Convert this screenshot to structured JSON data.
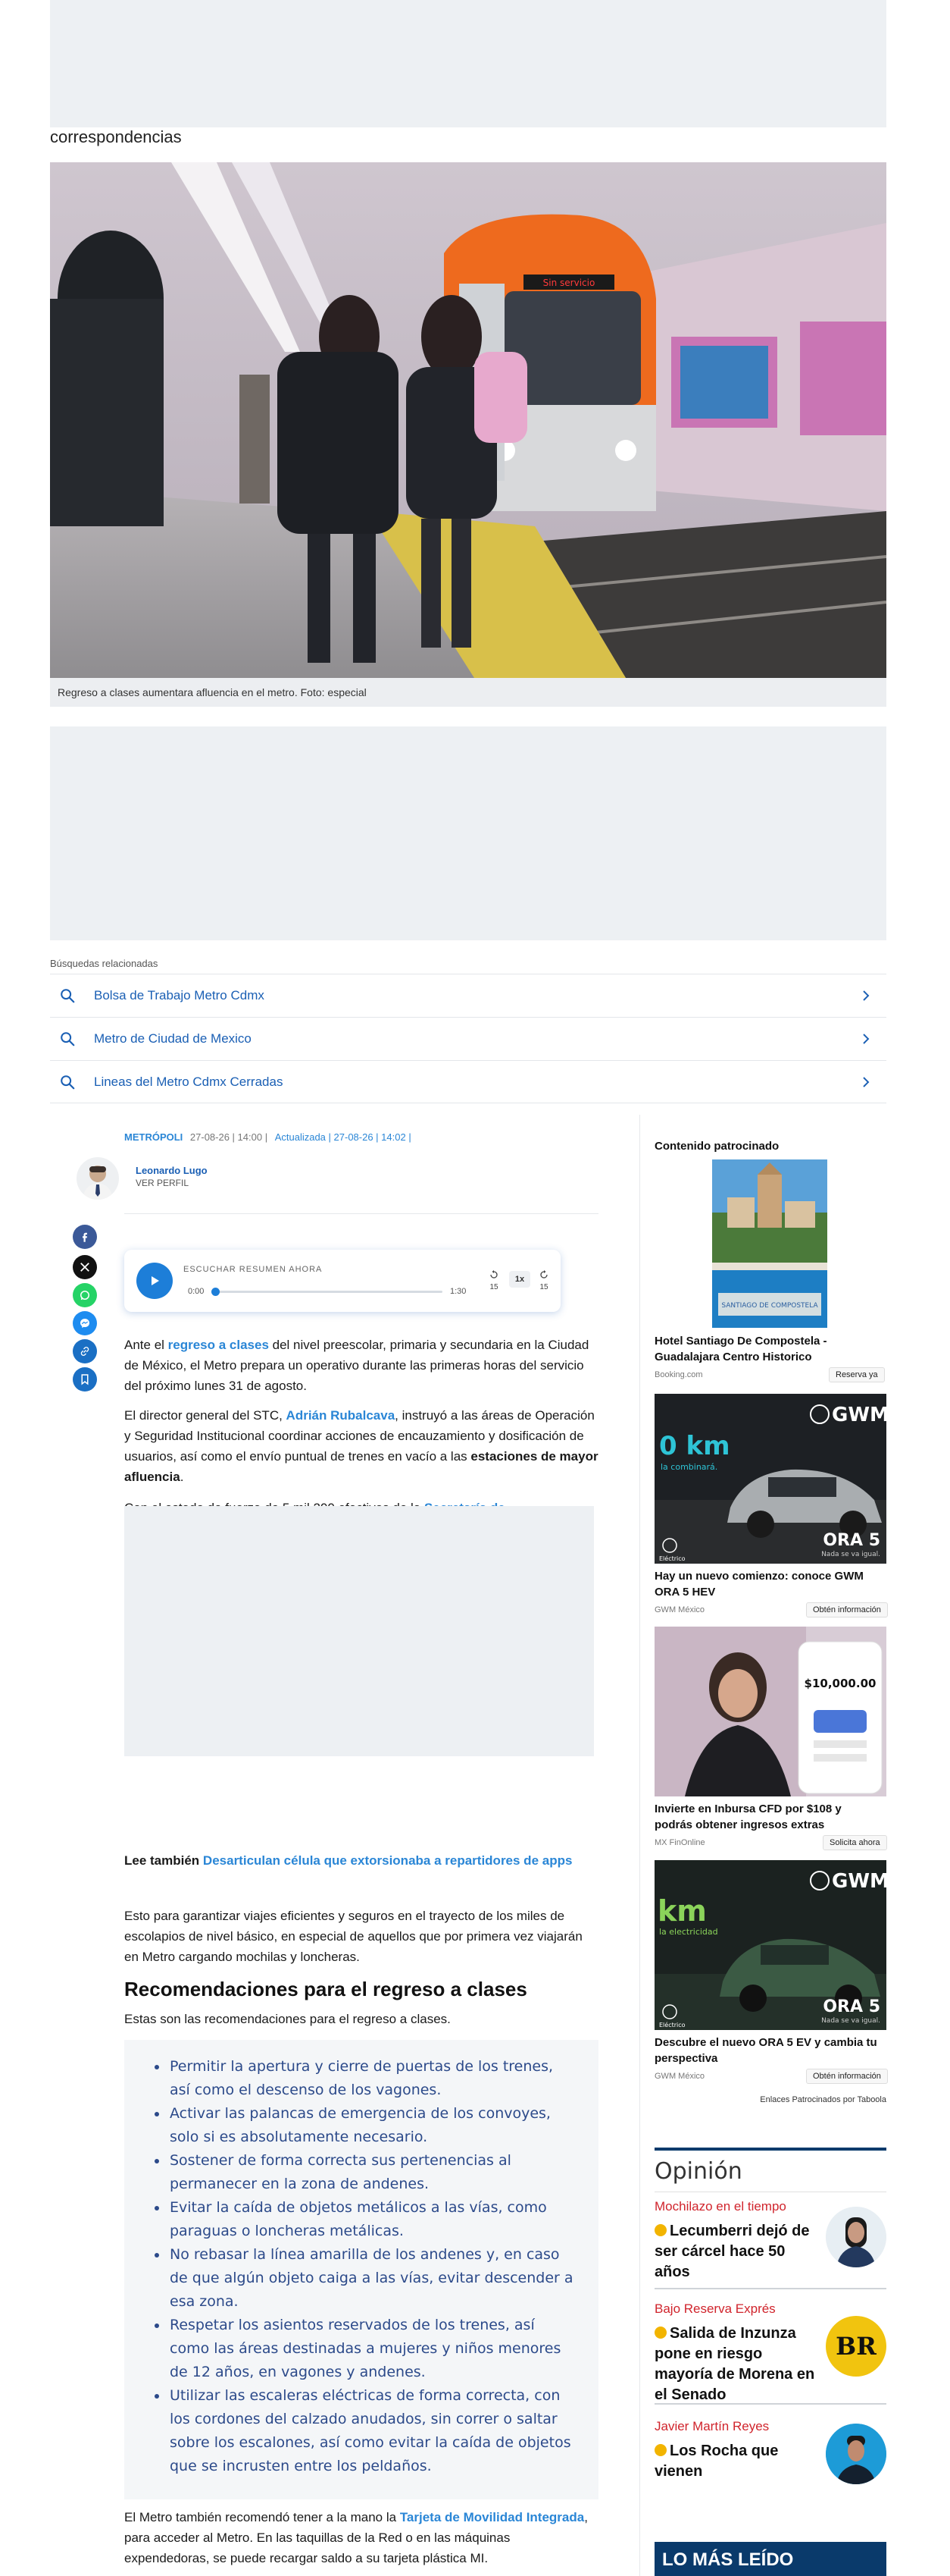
{
  "top_label": "correspondencias",
  "hero": {
    "caption": "Regreso a clases aumentara afluencia en el metro. Foto: especial",
    "train_sign": "Sin servicio"
  },
  "related": {
    "title": "Búsquedas relacionadas",
    "items": [
      "Bolsa de Trabajo Metro Cdmx",
      "Metro de Ciudad de Mexico",
      "Lineas del Metro Cdmx Cerradas"
    ]
  },
  "meta": {
    "section": "METRÓPOLI",
    "date": "27-08-26 | 14:00 |",
    "updated_label": "Actualizada",
    "updated_date": "| 27-08-26 | 14:02 |"
  },
  "author": {
    "name": "Leonardo Lugo",
    "profile_link": "VER PERFIL"
  },
  "audio": {
    "label": "ESCUCHAR RESUMEN AHORA",
    "current": "0:00",
    "duration": "1:30",
    "progress": 0.0,
    "rewind": "15",
    "forward": "15",
    "speed": "1x"
  },
  "article": {
    "p1_a": "Ante el ",
    "p1_link": "regreso a clases",
    "p1_b": " del nivel preescolar, primaria y secundaria en la Ciudad de México, el Metro prepara un operativo durante las primeras horas del servicio del próximo lunes 31 de agosto.",
    "p2_a": "El director general del STC, ",
    "p2_link": "Adrián Rubalcava",
    "p2_b": ", instruyó a las áreas de Operación y Seguridad Institucional coordinar acciones de encauzamiento y dosificación de usuarios, así como el envío puntual de trenes en vacío a las ",
    "p2_bold": "estaciones de mayor afluencia",
    "p2_c": ".",
    "p3_cut_a": "Con el estado de fuerza de 5 mil 200 efectivos de la ",
    "p3_cut_link": "Secretaría de",
    "also_label": "Lee también ",
    "also_link": "Desarticulan célula que extorsionaba a repartidores de apps",
    "p4": "Esto para garantizar viajes eficientes y seguros en el trayecto de los miles de escolapios de nivel básico, en especial de aquellos que por primera vez viajarán en Metro cargando mochilas y loncheras.",
    "h2": "Recomendaciones para el regreso a clases",
    "p5": "Estas son las recomendaciones para el regreso a clases.",
    "recommendations": [
      "Permitir la apertura y cierre de puertas de los trenes, así como el descenso de los vagones.",
      "Activar las palancas de emergencia de los convoyes, solo si es absolutamente necesario.",
      "Sostener de forma correcta sus pertenencias al permanecer en la zona de andenes.",
      "Evitar la caída de objetos metálicos a las vías, como paraguas o loncheras metálicas.",
      "No rebasar la línea amarilla de los andenes y, en caso de que algún objeto caiga a las vías, evitar descender a esa zona.",
      "Respetar los asientos reservados de los trenes, así como las áreas destinadas a mujeres y niños menores de 12 años, en vagones y andenes.",
      "Utilizar las escaleras eléctricas de forma correcta, con los cordones del calzado anudados, sin correr o saltar sobre los escalones, así como evitar la caída de objetos que se incrusten entre los peldaños."
    ],
    "p6_a": "El Metro también recomendó tener a la mano la ",
    "p6_link": "Tarjeta de Movilidad Integrada",
    "p6_b": ", para acceder al Metro. En las taquillas de la Red o en las máquinas expendedoras, se puede recargar saldo a su tarjeta plástica MI."
  },
  "sponsored": {
    "title": "Contenido patrocinado",
    "footer": "Enlaces Patrocinados por Taboola",
    "items": [
      {
        "title": "Hotel Santiago De Compostela - Guadalajara Centro Historico",
        "source": "Booking.com",
        "cta": "Reserva ya",
        "img_text": "SANTIAGO DE COMPOSTELA"
      },
      {
        "title": "Hay un nuevo comienzo: conoce GWM ORA 5 HEV",
        "source": "GWM México",
        "cta": "Obtén información",
        "brand": "GWM",
        "big": "0 km",
        "sub": "la combinará.",
        "model": "ORA 5",
        "model_sub": "Nada se va igual.",
        "tag": "Eléctrico"
      },
      {
        "title": "Invierte en Inbursa CFD por $108 y podrás obtener ingresos extras",
        "source": "MX FinOnline",
        "cta": "Solicita ahora",
        "amount": "$10,000.00"
      },
      {
        "title": "Descubre el nuevo ORA 5 EV y cambia tu perspectiva",
        "source": "GWM México",
        "cta": "Obtén información",
        "brand": "GWM",
        "big": "km",
        "sub": "la electricidad",
        "model": "ORA 5",
        "model_sub": "Nada se va igual.",
        "tag": "Eléctrico"
      }
    ]
  },
  "opinion": {
    "title": "Opinión",
    "items": [
      {
        "author": "Mochilazo en el tiempo",
        "title": "Lecumberri dejó de ser cárcel hace 50 años"
      },
      {
        "author": "Bajo Reserva Exprés",
        "title": "Salida de Inzunza pone en riesgo mayoría de Morena en el Senado",
        "logo_text": "BR"
      },
      {
        "author": "Javier Martín Reyes",
        "title": "Los Rocha que vienen"
      }
    ]
  },
  "most_read": {
    "title": "LO MÁS LEÍDO"
  },
  "colors": {
    "accent_blue": "#1d7ed8",
    "ad_gray": "#edf0f3",
    "opinion_red": "#d0242c",
    "navy": "#0a3a6b"
  }
}
